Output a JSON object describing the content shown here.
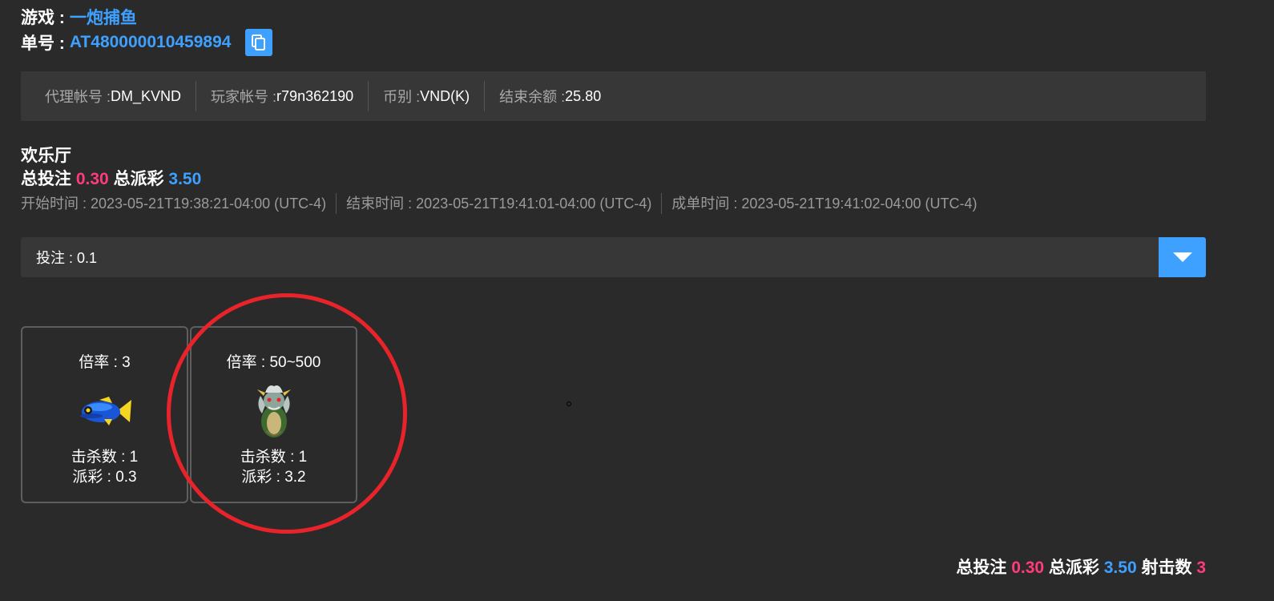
{
  "header": {
    "game_label": "游戏 :",
    "game_name": "一炮捕鱼",
    "order_label": "单号 :",
    "order_id": "AT480000010459894"
  },
  "info": {
    "agent_label": "代理帐号 : ",
    "agent_value": "DM_KVND",
    "player_label": "玩家帐号 : ",
    "player_value": "r79n362190",
    "currency_label": "币别 : ",
    "currency_value": "VND(K)",
    "balance_label": "结束余额 : ",
    "balance_value": "25.80"
  },
  "room": {
    "name": "欢乐厅",
    "total_bet_label": "总投注",
    "total_bet": "0.30",
    "total_payout_label": "总派彩",
    "total_payout": "3.50"
  },
  "times": {
    "start": "开始时间 : 2023-05-21T19:38:21-04:00 (UTC-4)",
    "end": "结束时间 : 2023-05-21T19:41:01-04:00 (UTC-4)",
    "settle": "成单时间 : 2023-05-21T19:41:02-04:00 (UTC-4)"
  },
  "bet_select": {
    "label": "投注 : 0.1"
  },
  "cards": [
    {
      "rate": "倍率 : 3",
      "kills": "击杀数 : 1",
      "payout": "派彩 : 0.3",
      "icon": "blue-fish-icon"
    },
    {
      "rate": "倍率 : 50~500",
      "kills": "击杀数 : 1",
      "payout": "派彩 : 3.2",
      "icon": "dragon-icon"
    }
  ],
  "footer": {
    "total_bet_label": "总投注",
    "total_bet": "0.30",
    "total_payout_label": "总派彩",
    "total_payout": "3.50",
    "shots_label": "射击数",
    "shots": "3"
  },
  "colors": {
    "background": "#2a2a2a",
    "panel": "#373737",
    "accent_blue": "#3ea0ff",
    "accent_pink": "#ff3b7a",
    "highlight_red": "#e8232a"
  }
}
